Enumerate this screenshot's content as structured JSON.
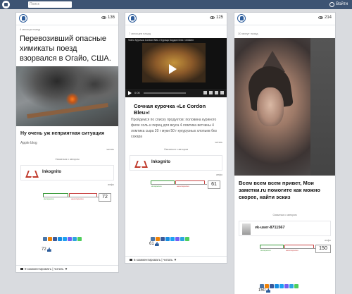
{
  "topbar": {
    "search_placeholder": "Поиск",
    "login_label": "Войти"
  },
  "colors": {
    "topbar": "#3d5473",
    "accent_blue": "#2d5d9c",
    "vote_up": "#3a9a3a",
    "vote_down": "#c84444"
  },
  "posts": [
    {
      "views": "136",
      "time": "4 месяца назад",
      "headline": "Перевозивший опасные химикаты поезд взорвался в Огайо, США.",
      "image_icon": "train-explosion-photo",
      "subhead": "Ну очень уж неприятная ситуация",
      "source": "Apple blog",
      "more_link": "читать",
      "author_link": "Связаться с автором",
      "author_name": "Inkognito",
      "author_link2": "инфо",
      "vote_up_label": "интересно",
      "vote_down_label": "неинтересно",
      "vote_score": "72",
      "likes": "72",
      "footer": "9 комментировать | читать ▼"
    },
    {
      "views": "125",
      "time": "7 месяцев назад",
      "video_title": "Video Курочка Cordon Bleu / Курица Кордон Блю / chicken",
      "video_time": "0:00",
      "subhead": "Сочная курочка «Le Cordon Bleu»!",
      "text": "Пройдемся по списку продуктов: половина куриного филе соль и перец для вкуса 4 ломтика ветчины 4 ломтика сыра 20 г муки 50 г кукурузных хлопьев без сахара",
      "more_link": "читать",
      "author_link": "Связаться с автором",
      "author_name": "Inkognito",
      "author_link2": "инфо",
      "vote_up_label": "интересно",
      "vote_down_label": "неинтересно",
      "vote_score": "61",
      "likes": "61",
      "footer": "6 комментировать | читать ▼"
    },
    {
      "views": "214",
      "time": "30 минут назад",
      "image_icon": "tattoo-sleeve-photo",
      "subhead": "Всем всем всем привет, Мои заметки.ru помогите как можно скорее, найти эскиз",
      "author_link": "Связаться с автором",
      "author_name": "vk-user-8711567",
      "author_link2": "инфо",
      "vote_up_label": "интересно",
      "vote_down_label": "неинтересно",
      "vote_score": "150",
      "likes": "150"
    }
  ]
}
